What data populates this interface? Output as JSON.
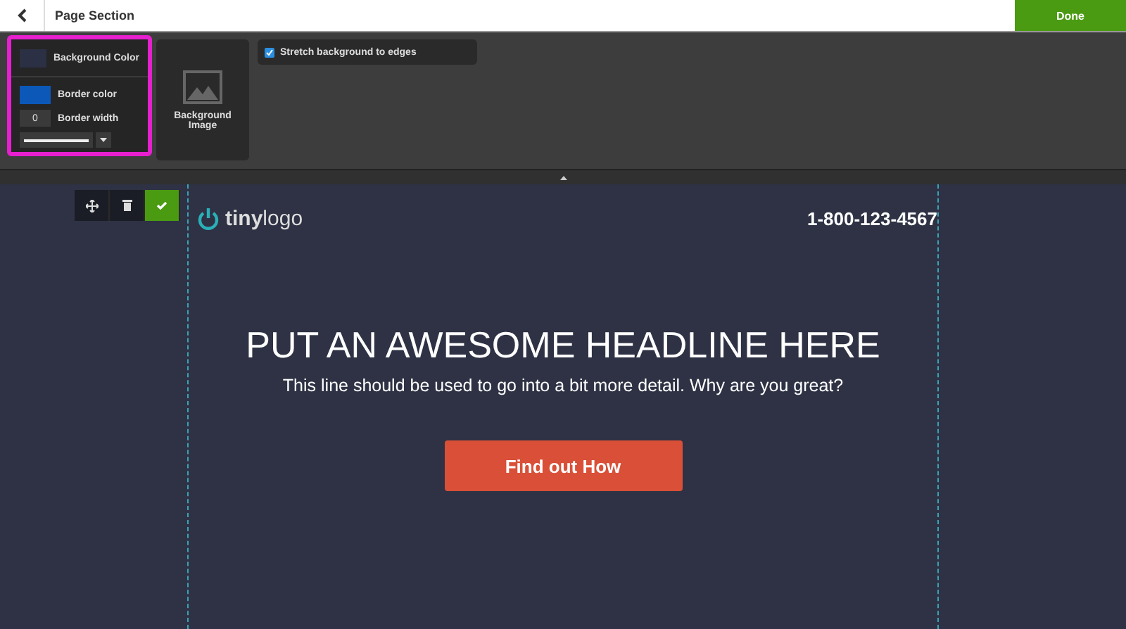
{
  "header": {
    "title": "Page Section",
    "done": "Done"
  },
  "style_panel": {
    "background_color": {
      "label": "Background Color",
      "color": "#2b3045"
    },
    "border_color": {
      "label": "Border color",
      "color": "#0b58b8"
    },
    "border_width": {
      "value": "0",
      "label": "Border width"
    }
  },
  "background_image": {
    "label": "Background Image"
  },
  "stretch": {
    "label": "Stretch background to edges",
    "checked": true
  },
  "section": {
    "logo": {
      "bold": "tiny",
      "light": "logo"
    },
    "phone": "1-800-123-4567",
    "headline": "PUT AN AWESOME HEADLINE HERE",
    "subline": "This line should be used to go into a bit more detail. Why are you great?",
    "cta": "Find out How"
  }
}
